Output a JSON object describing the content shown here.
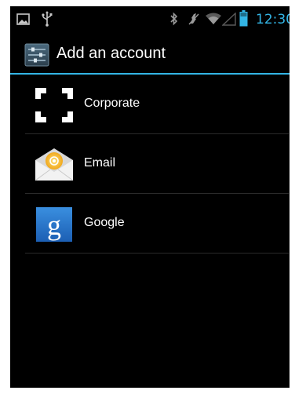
{
  "status_bar": {
    "time": "12:30",
    "icons": [
      "image-notification-icon",
      "usb-icon",
      "bluetooth-icon",
      "vibrate-icon",
      "wifi-icon",
      "signal-icon",
      "battery-icon"
    ],
    "accent_color": "#33b5e5"
  },
  "action_bar": {
    "title": "Add an account",
    "app_icon": "settings-app-icon",
    "divider_color": "#33b5e5"
  },
  "accounts": [
    {
      "label": "Corporate",
      "icon": "corporate-exchange-icon"
    },
    {
      "label": "Email",
      "icon": "email-envelope-icon"
    },
    {
      "label": "Google",
      "icon": "google-g-icon"
    }
  ]
}
